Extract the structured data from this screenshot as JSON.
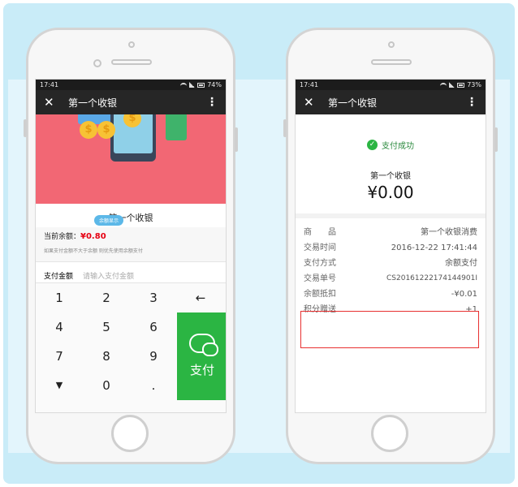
{
  "left_phone": {
    "status": {
      "time": "17:41",
      "battery": "74%"
    },
    "titlebar": {
      "title": "第一个收银"
    },
    "store_title": "第一个收银",
    "tooltip": "余额显示",
    "balance": {
      "label": "当前余额：",
      "amount": "¥0.80",
      "note": "如果支付金额不大于余额 则优先使用余额支付"
    },
    "amount_row": {
      "label": "支付金额",
      "placeholder": "请输入支付金额"
    },
    "keypad": {
      "keys": [
        "1",
        "2",
        "3",
        "←",
        "4",
        "5",
        "6",
        "7",
        "8",
        "9",
        "▼",
        "0",
        "."
      ],
      "pay_label": "支付"
    }
  },
  "right_phone": {
    "status": {
      "time": "17:41",
      "battery": "73%"
    },
    "titlebar": {
      "title": "第一个收银"
    },
    "success_text": "支付成功",
    "merchant": "第一个收银",
    "amount": "¥0.00",
    "details": [
      {
        "label": "商　　品",
        "value": "第一个收银消费"
      },
      {
        "label": "交易时间",
        "value": "2016-12-22 17:41:44"
      },
      {
        "label": "支付方式",
        "value": "余额支付"
      },
      {
        "label": "交易单号",
        "value": "CS20161222174144901I"
      },
      {
        "label": "余额抵扣",
        "value": "-¥0.01"
      },
      {
        "label": "积分赠送",
        "value": "+1"
      }
    ]
  },
  "colors": {
    "accent_green": "#2bb543",
    "banner": "#f26774",
    "highlight_red": "#e83030"
  }
}
